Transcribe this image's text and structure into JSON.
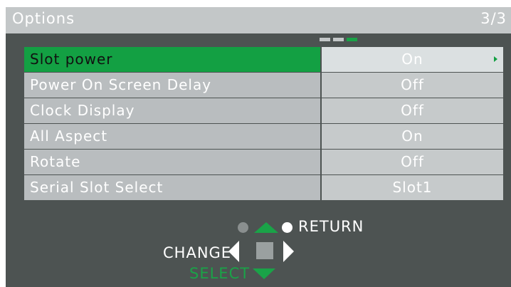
{
  "header": {
    "title": "Options",
    "page": "3/3",
    "page_indicator": {
      "total": 3,
      "current": 3
    }
  },
  "menu": {
    "items": [
      {
        "label": "Slot power",
        "value": "On",
        "selected": true
      },
      {
        "label": "Power On Screen Delay",
        "value": "Off",
        "selected": false
      },
      {
        "label": "Clock Display",
        "value": "Off",
        "selected": false
      },
      {
        "label": "All Aspect",
        "value": "On",
        "selected": false
      },
      {
        "label": "Rotate",
        "value": "Off",
        "selected": false
      },
      {
        "label": "Serial Slot Select",
        "value": "Slot1",
        "selected": false
      }
    ]
  },
  "controls": {
    "return_label": "RETURN",
    "change_label": "CHANGE",
    "select_label": "SELECT"
  },
  "colors": {
    "background": "#4d5352",
    "accent": "#13a043",
    "row": "#b9bdbf",
    "titlebar": "#c3c7c8"
  }
}
